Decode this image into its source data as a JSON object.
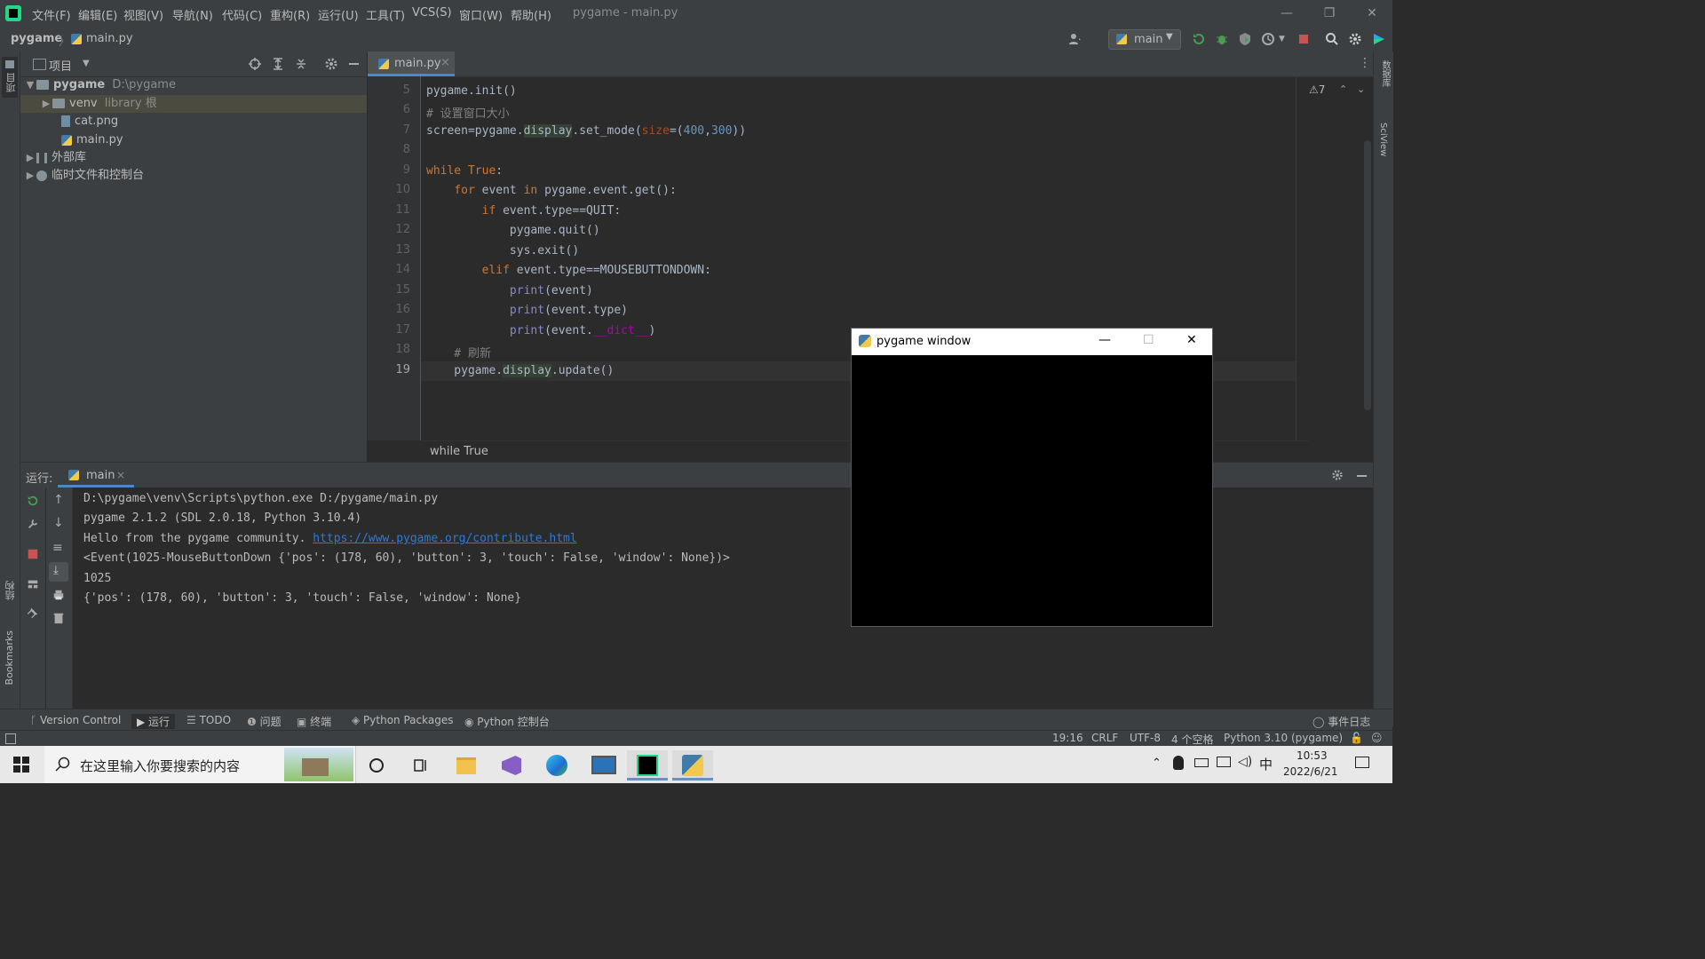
{
  "menubar": {
    "items": [
      "文件(F)",
      "编辑(E)",
      "视图(V)",
      "导航(N)",
      "代码(C)",
      "重构(R)",
      "运行(U)",
      "工具(T)",
      "VCS(S)",
      "窗口(W)",
      "帮助(H)"
    ],
    "window_title": "pygame - main.py",
    "minimize": "—",
    "restore": "❐",
    "close": "✕"
  },
  "navbar": {
    "project": "pygame",
    "separator": "〉",
    "file": "main.py",
    "run_config": "main"
  },
  "project_panel": {
    "title": "项目",
    "tree": {
      "root_name": "pygame",
      "root_path": "D:\\pygame",
      "venv_name": "venv",
      "venv_hint": "library 根",
      "file1": "cat.png",
      "file2": "main.py",
      "external": "外部库",
      "scratch": "临时文件和控制台"
    }
  },
  "left_strip": {
    "project_label": "项目",
    "structure_label": "结构",
    "bookmarks_label": "Bookmarks"
  },
  "right_strip": {
    "database_label": "数据库",
    "sciview_label": "SciView"
  },
  "editor": {
    "tab_label": "main.py",
    "tab_close": "×",
    "warnings": "⚠7",
    "line_numbers": [
      "5",
      "6",
      "7",
      "8",
      "9",
      "10",
      "11",
      "12",
      "13",
      "14",
      "15",
      "16",
      "17",
      "18",
      "19"
    ],
    "breadcrumb": "while True"
  },
  "run_panel": {
    "label": "运行:",
    "tab": "main",
    "tab_close": "×",
    "output": [
      "D:\\pygame\\venv\\Scripts\\python.exe D:/pygame/main.py",
      "pygame 2.1.2 (SDL 2.0.18, Python 3.10.4)",
      "Hello from the pygame community. ",
      "<Event(1025-MouseButtonDown {'pos': (178, 60), 'button': 3, 'touch': False, 'window': None})>",
      "1025",
      "{'pos': (178, 60), 'button': 3, 'touch': False, 'window': None}"
    ],
    "link": "https://www.pygame.org/contribute.html"
  },
  "toolwindows": {
    "version_control": "Version Control",
    "run": "运行",
    "todo": "TODO",
    "problems": "问题",
    "terminal": "终端",
    "packages": "Python Packages",
    "console": "Python 控制台",
    "event_log": "事件日志"
  },
  "statusbar": {
    "position": "19:16",
    "line_sep": "CRLF",
    "encoding": "UTF-8",
    "indent": "4 个空格",
    "interpreter": "Python 3.10 (pygame)"
  },
  "pygame_window": {
    "title": "pygame window",
    "minimize": "—",
    "maximize": "☐",
    "close": "✕"
  },
  "taskbar": {
    "search_placeholder": "在这里输入你要搜索的内容",
    "time": "10:53",
    "date": "2022/6/21",
    "ime": "中"
  },
  "colors": {
    "accent": "#4a88c7",
    "editor_bg": "#2b2b2b",
    "panel_bg": "#3c3f41",
    "keyword": "#cc7832",
    "link": "#287bde"
  }
}
